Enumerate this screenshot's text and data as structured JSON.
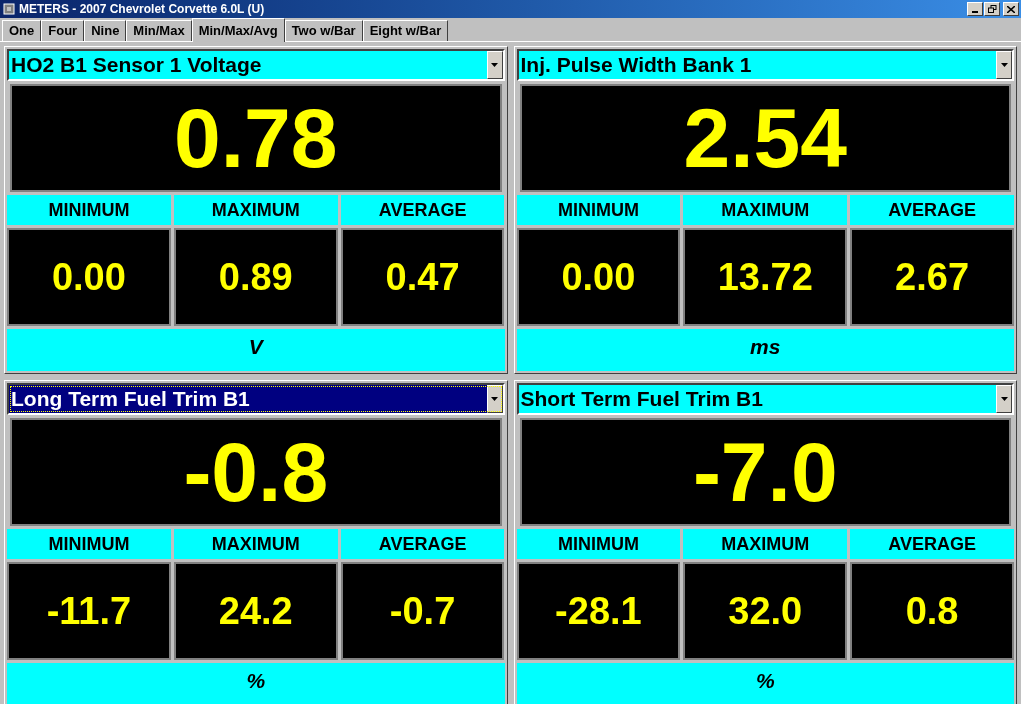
{
  "window": {
    "title": "METERS - 2007 Chevrolet Corvette 6.0L (U)"
  },
  "tabs": [
    {
      "label": "One",
      "selected": false
    },
    {
      "label": "Four",
      "selected": false
    },
    {
      "label": "Nine",
      "selected": false
    },
    {
      "label": "Min/Max",
      "selected": false
    },
    {
      "label": "Min/Max/Avg",
      "selected": true
    },
    {
      "label": "Two w/Bar",
      "selected": false
    },
    {
      "label": "Eight w/Bar",
      "selected": false
    }
  ],
  "meters": [
    {
      "parameter": "HO2 B1 Sensor 1 Voltage",
      "focused": false,
      "value": "0.78",
      "stats": [
        {
          "label": "MINIMUM",
          "value": "0.00"
        },
        {
          "label": "MAXIMUM",
          "value": "0.89"
        },
        {
          "label": "AVERAGE",
          "value": "0.47"
        }
      ],
      "unit": "V"
    },
    {
      "parameter": "Inj. Pulse Width Bank 1",
      "focused": false,
      "value": "2.54",
      "stats": [
        {
          "label": "MINIMUM",
          "value": "0.00"
        },
        {
          "label": "MAXIMUM",
          "value": "13.72"
        },
        {
          "label": "AVERAGE",
          "value": "2.67"
        }
      ],
      "unit": "ms"
    },
    {
      "parameter": "Long Term Fuel Trim B1",
      "focused": true,
      "value": "-0.8",
      "stats": [
        {
          "label": "MINIMUM",
          "value": "-11.7"
        },
        {
          "label": "MAXIMUM",
          "value": "24.2"
        },
        {
          "label": "AVERAGE",
          "value": "-0.7"
        }
      ],
      "unit": "%"
    },
    {
      "parameter": "Short Term Fuel Trim B1",
      "focused": false,
      "value": "-7.0",
      "stats": [
        {
          "label": "MINIMUM",
          "value": "-28.1"
        },
        {
          "label": "MAXIMUM",
          "value": "32.0"
        },
        {
          "label": "AVERAGE",
          "value": "0.8"
        }
      ],
      "unit": "%"
    }
  ]
}
